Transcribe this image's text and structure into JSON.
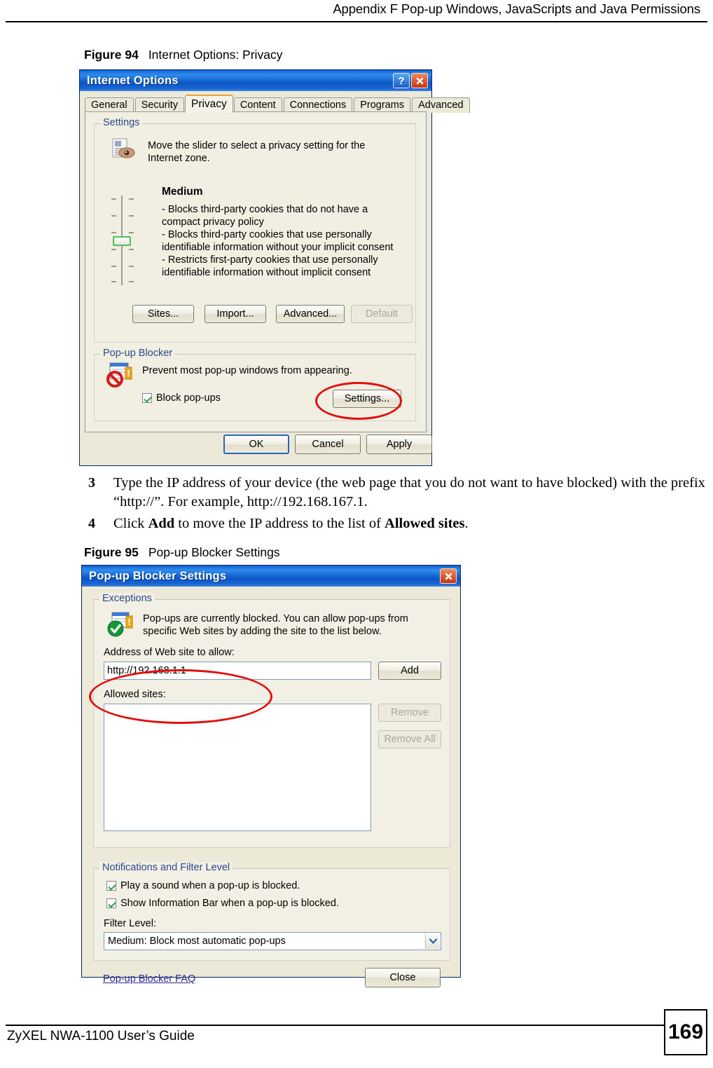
{
  "page": {
    "header_text": "Appendix F Pop-up Windows, JavaScripts and Java Permissions",
    "footer_text": "ZyXEL NWA-1100 User’s Guide",
    "page_number": "169"
  },
  "figure94": {
    "label": "Figure 94",
    "title": "Internet Options: Privacy",
    "dialog": {
      "title": "Internet Options",
      "help_button": "?",
      "close_button": "✕",
      "tabs": [
        {
          "label": "General",
          "active": false
        },
        {
          "label": "Security",
          "active": false
        },
        {
          "label": "Privacy",
          "active": true
        },
        {
          "label": "Content",
          "active": false
        },
        {
          "label": "Connections",
          "active": false
        },
        {
          "label": "Programs",
          "active": false
        },
        {
          "label": "Advanced",
          "active": false
        }
      ],
      "settings_group": {
        "title": "Settings",
        "description": "Move the slider to select a privacy setting for the Internet zone.",
        "level_name": "Medium",
        "level_details": [
          "- Blocks third-party cookies that do not have a compact privacy policy",
          "- Blocks third-party cookies that use personally identifiable information without your implicit consent",
          "- Restricts first-party cookies that use personally identifiable information without implicit consent"
        ],
        "buttons": [
          {
            "label": "Sites...",
            "disabled": false
          },
          {
            "label": "Import...",
            "disabled": false
          },
          {
            "label": "Advanced...",
            "disabled": false
          },
          {
            "label": "Default",
            "disabled": true
          }
        ]
      },
      "popup_group": {
        "title": "Pop-up Blocker",
        "description": "Prevent most pop-up windows from appearing.",
        "checkbox_label": "Block pop-ups",
        "checkbox_checked": true,
        "settings_button": "Settings..."
      },
      "footer_buttons": [
        {
          "label": "OK",
          "default": true
        },
        {
          "label": "Cancel",
          "default": false
        },
        {
          "label": "Apply",
          "default": false
        }
      ]
    }
  },
  "steps": [
    {
      "number": "3",
      "parts": [
        {
          "text": "Type the IP address of your device (the web page that you do not want to have blocked) with the prefix “http://”. For example, http://192.168.167.1.",
          "bold": false
        }
      ]
    },
    {
      "number": "4",
      "parts": [
        {
          "text": "Click ",
          "bold": false
        },
        {
          "text": "Add",
          "bold": true
        },
        {
          "text": " to move the IP address to the list of ",
          "bold": false
        },
        {
          "text": "Allowed sites",
          "bold": true
        },
        {
          "text": ".",
          "bold": false
        }
      ]
    }
  ],
  "figure95": {
    "label": "Figure 95",
    "title": "Pop-up Blocker Settings",
    "dialog": {
      "title": "Pop-up Blocker Settings",
      "close_button": "✕",
      "exceptions_group": {
        "title": "Exceptions",
        "description": "Pop-ups are currently blocked.  You can allow pop-ups from specific Web sites by adding the site to the list below.",
        "address_label": "Address of Web site to allow:",
        "address_value": "http://192.168.1.1",
        "add_button": "Add",
        "allowed_label": "Allowed sites:",
        "allowed_sites": [],
        "remove_button": "Remove",
        "remove_all_button": "Remove All"
      },
      "notifications_group": {
        "title": "Notifications and Filter Level",
        "checkboxes": [
          {
            "label": "Play a sound when a pop-up is blocked.",
            "checked": true
          },
          {
            "label": "Show Information Bar when a pop-up is blocked.",
            "checked": true
          }
        ],
        "filter_label": "Filter Level:",
        "filter_value": "Medium: Block most automatic pop-ups"
      },
      "faq_link": "Pop-up Blocker FAQ",
      "close_label": "Close"
    }
  },
  "colors": {
    "titlebar_blue": "#0b55c6",
    "dialog_face": "#ece9d8",
    "highlight_red": "#e01010",
    "tab_accent": "#f0a030",
    "group_title": "#2b4a8b",
    "link": "#2b2b8f"
  }
}
